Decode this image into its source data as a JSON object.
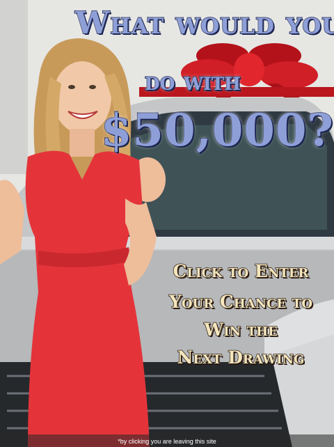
{
  "ad": {
    "headline": {
      "line1": "What would you",
      "line2": "do with",
      "amount": "$50,000?"
    },
    "cta": {
      "line1": "Click to Enter",
      "line2": "Your Chance to",
      "line3": "Win the",
      "line4": "Next Drawing"
    },
    "disclaimer": "*by clicking you are leaving this site",
    "colors": {
      "headline_fill": "#8e9fd8",
      "headline_outline": "#1c2550",
      "cta_fill": "#f4e6bd",
      "dress": "#e8333a",
      "bow": "#c8171f",
      "car": "#c7c9cb"
    }
  }
}
